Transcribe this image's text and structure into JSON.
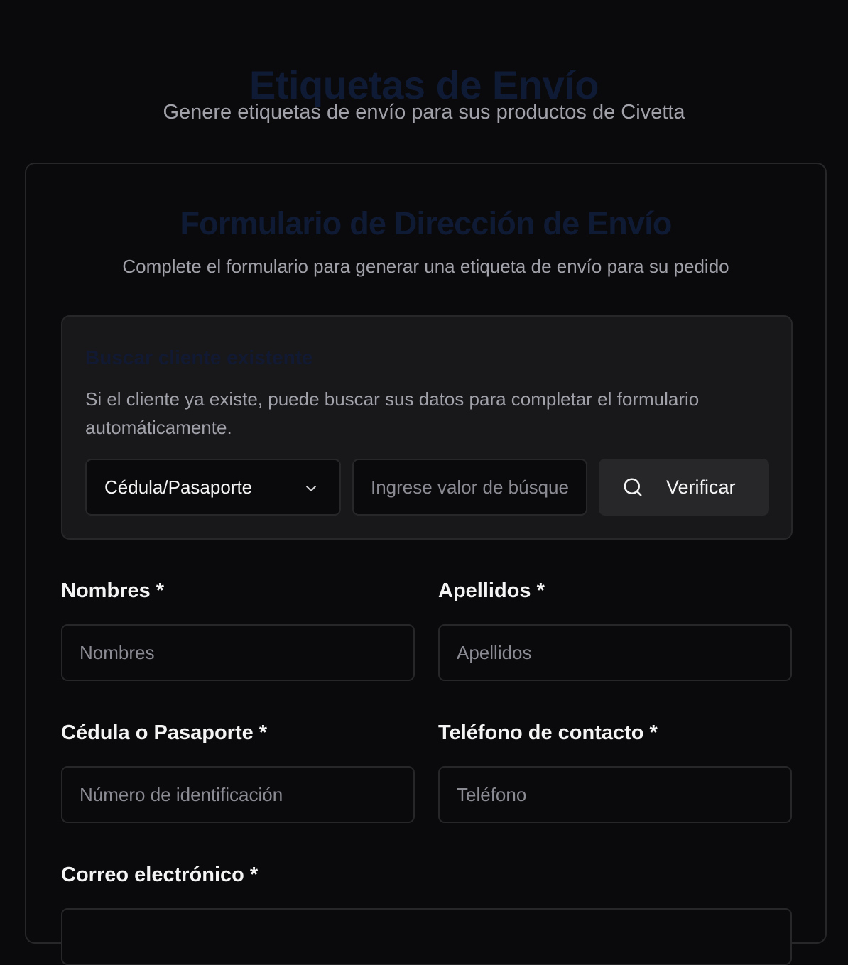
{
  "header": {
    "title": "Etiquetas de Envío",
    "subtitle": "Genere etiquetas de envío para sus productos de Civetta"
  },
  "card": {
    "title": "Formulario de Dirección de Envío",
    "description": "Complete el formulario para generar una etiqueta de envío para su pedido"
  },
  "search": {
    "title": "Buscar cliente existente",
    "description": "Si el cliente ya existe, puede buscar sus datos para completar el formulario automáticamente.",
    "select_value": "Cédula/Pasaporte",
    "input_placeholder": "Ingrese valor de búsqueda",
    "button_label": "Verificar",
    "button_icon": "search-icon"
  },
  "fields": {
    "nombres": {
      "label": "Nombres *",
      "placeholder": "Nombres"
    },
    "apellidos": {
      "label": "Apellidos *",
      "placeholder": "Apellidos"
    },
    "cedula": {
      "label": "Cédula o Pasaporte *",
      "placeholder": "Número de identificación"
    },
    "telefono": {
      "label": "Teléfono de contacto *",
      "placeholder": "Teléfono"
    },
    "correo": {
      "label": "Correo electrónico *",
      "placeholder": ""
    }
  },
  "colors": {
    "background": "#0a0a0c",
    "panel": "#18181b",
    "border": "#27272a",
    "muted_text": "#a1a1aa",
    "title_dark_blue": "#0f1a35"
  }
}
